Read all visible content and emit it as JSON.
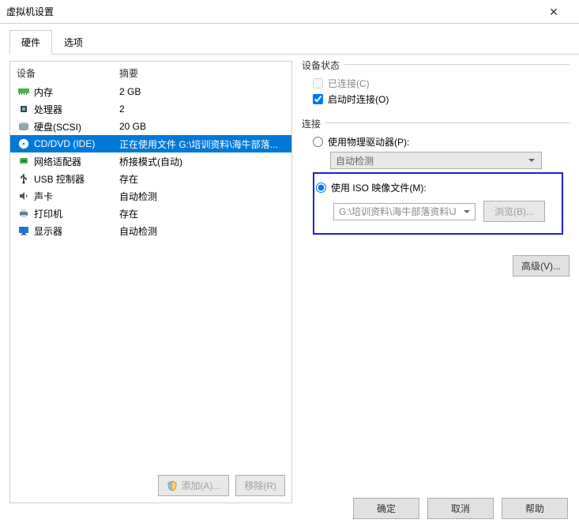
{
  "window": {
    "title": "虚拟机设置"
  },
  "tabs": {
    "hardware": "硬件",
    "options": "选项"
  },
  "headers": {
    "device": "设备",
    "summary": "摘要"
  },
  "devices": [
    {
      "name": "内存",
      "summary": "2 GB",
      "icon": "memory"
    },
    {
      "name": "处理器",
      "summary": "2",
      "icon": "cpu"
    },
    {
      "name": "硬盘(SCSI)",
      "summary": "20 GB",
      "icon": "disk"
    },
    {
      "name": "CD/DVD (IDE)",
      "summary": "正在使用文件 G:\\培训资料\\海牛部落...",
      "icon": "cd",
      "selected": true
    },
    {
      "name": "网络适配器",
      "summary": "桥接模式(自动)",
      "icon": "net"
    },
    {
      "name": "USB 控制器",
      "summary": "存在",
      "icon": "usb"
    },
    {
      "name": "声卡",
      "summary": "自动检测",
      "icon": "sound"
    },
    {
      "name": "打印机",
      "summary": "存在",
      "icon": "printer"
    },
    {
      "name": "显示器",
      "summary": "自动检测",
      "icon": "display"
    }
  ],
  "buttons": {
    "add": "添加(A)...",
    "remove": "移除(R)",
    "browse": "浏览(B)...",
    "advanced": "高级(V)...",
    "ok": "确定",
    "cancel": "取消",
    "help": "帮助"
  },
  "state": {
    "legend": "设备状态",
    "connected": "已连接(C)",
    "connect_on_start": "启动时连接(O)"
  },
  "connection": {
    "legend": "连接",
    "physical": "使用物理驱动器(P):",
    "physical_value": "自动检测",
    "iso": "使用 ISO 映像文件(M):",
    "iso_path": "G:\\培训资料\\海牛部落资料\\J"
  }
}
